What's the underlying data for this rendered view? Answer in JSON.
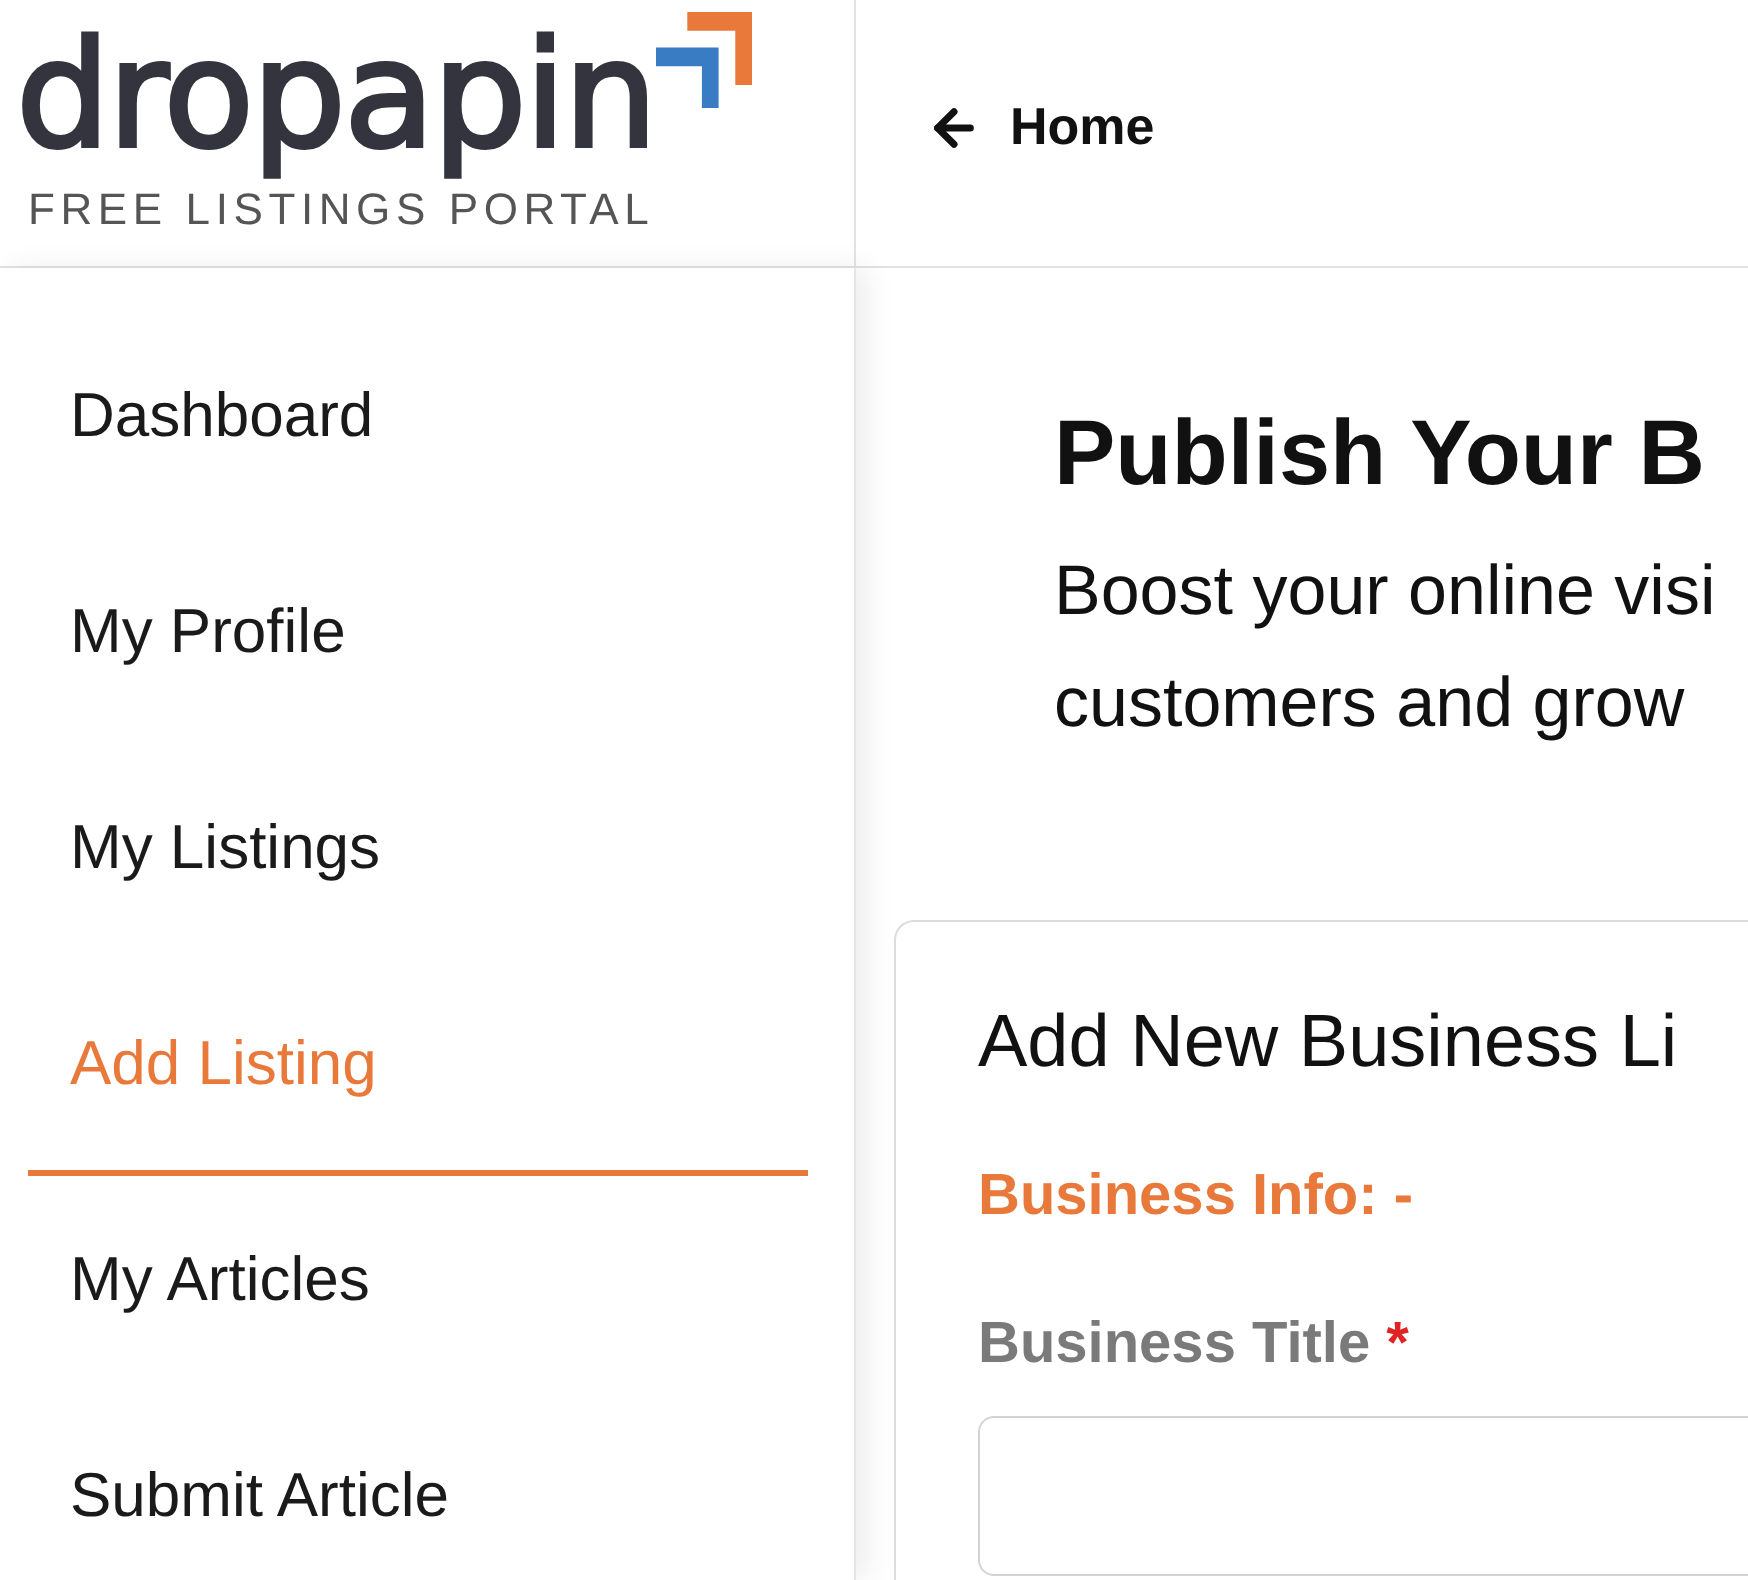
{
  "header": {
    "logo": {
      "wordmark": "dropapin",
      "tagline": "FREE LISTINGS PORTAL"
    },
    "back_link": {
      "label": "Home"
    }
  },
  "sidebar": {
    "items": [
      {
        "label": "Dashboard",
        "selected": false
      },
      {
        "label": "My Profile",
        "selected": false
      },
      {
        "label": "My Listings",
        "selected": false
      },
      {
        "label": "Add Listing",
        "selected": true
      },
      {
        "label": "My Articles",
        "selected": false
      },
      {
        "label": "Submit Article",
        "selected": false
      }
    ]
  },
  "main": {
    "title": "Publish Your B",
    "intro_lines": [
      "Boost your online visi",
      "customers and grow"
    ]
  },
  "card": {
    "title": "Add New Business Li",
    "section": "Business Info: -",
    "fields": [
      {
        "label": "Business Title",
        "required_mark": "*"
      }
    ]
  }
}
